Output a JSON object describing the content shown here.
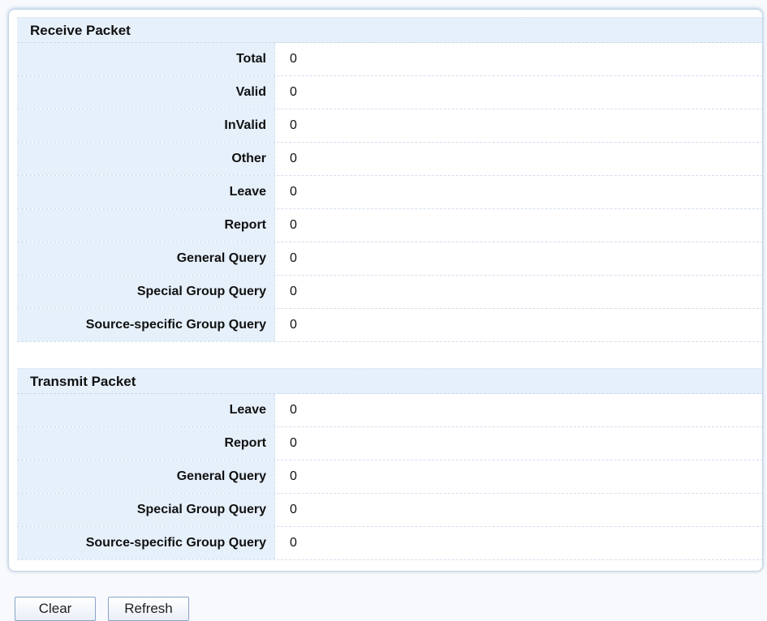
{
  "receive": {
    "title": "Receive Packet",
    "rows": [
      {
        "label": "Total",
        "value": "0"
      },
      {
        "label": "Valid",
        "value": "0"
      },
      {
        "label": "InValid",
        "value": "0"
      },
      {
        "label": "Other",
        "value": "0"
      },
      {
        "label": "Leave",
        "value": "0"
      },
      {
        "label": "Report",
        "value": "0"
      },
      {
        "label": "General Query",
        "value": "0"
      },
      {
        "label": "Special Group Query",
        "value": "0"
      },
      {
        "label": "Source-specific Group Query",
        "value": "0"
      }
    ]
  },
  "transmit": {
    "title": "Transmit Packet",
    "rows": [
      {
        "label": "Leave",
        "value": "0"
      },
      {
        "label": "Report",
        "value": "0"
      },
      {
        "label": "General Query",
        "value": "0"
      },
      {
        "label": "Special Group Query",
        "value": "0"
      },
      {
        "label": "Source-specific Group Query",
        "value": "0"
      }
    ]
  },
  "buttons": {
    "clear_label": "Clear",
    "refresh_label": "Refresh"
  },
  "colors": {
    "label_bg": "#e6f0fb",
    "panel_border": "#c9d6e6"
  }
}
